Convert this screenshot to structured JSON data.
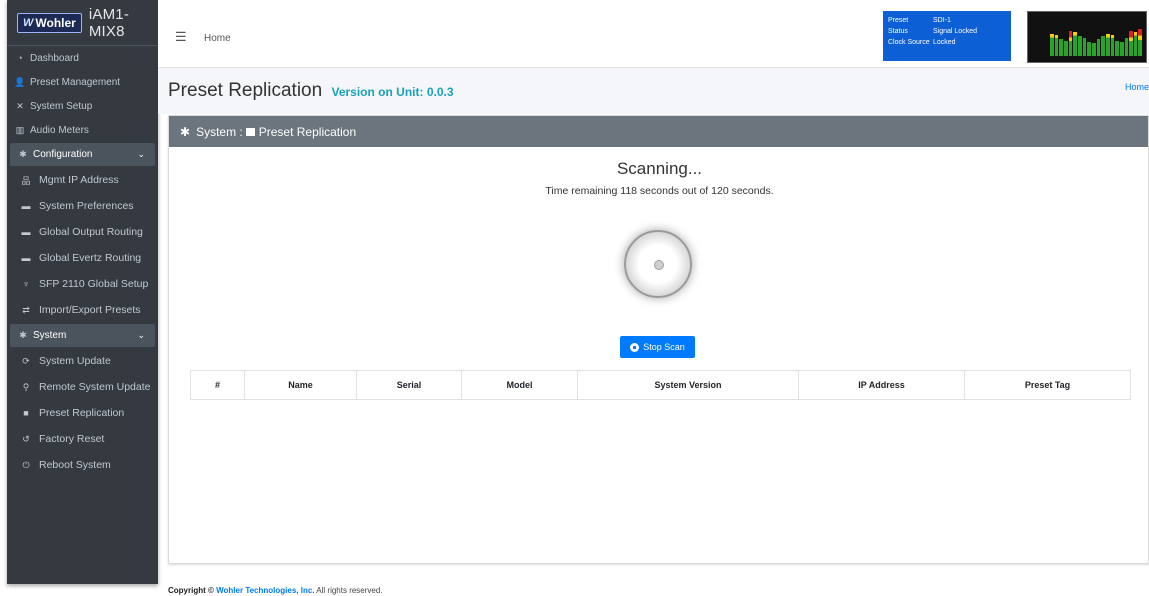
{
  "brand": {
    "logo": "Wohler",
    "product": "iAM1-MIX8"
  },
  "sidebar": {
    "items": [
      {
        "label": "Dashboard",
        "icon": "tachometer-icon"
      },
      {
        "label": "Preset Management",
        "icon": "users-icon"
      },
      {
        "label": "System Setup",
        "icon": "tools-icon"
      },
      {
        "label": "Audio Meters",
        "icon": "chart-icon"
      }
    ],
    "configuration": {
      "label": "Configuration",
      "items": [
        {
          "label": "Mgmt IP Address",
          "icon": "network-icon"
        },
        {
          "label": "System Preferences",
          "icon": "keyboard-icon"
        },
        {
          "label": "Global Output Routing",
          "icon": "keyboard-icon"
        },
        {
          "label": "Global Evertz Routing",
          "icon": "keyboard-icon"
        },
        {
          "label": "SFP 2110 Global Setup",
          "icon": "plug-icon"
        },
        {
          "label": "Import/Export Presets",
          "icon": "exchange-icon"
        }
      ]
    },
    "system": {
      "label": "System",
      "items": [
        {
          "label": "System Update",
          "icon": "sync-icon"
        },
        {
          "label": "Remote System Update",
          "icon": "sitemap-icon"
        },
        {
          "label": "Preset Replication",
          "icon": "clone-icon"
        },
        {
          "label": "Factory Reset",
          "icon": "undo-icon"
        },
        {
          "label": "Reboot System",
          "icon": "power-icon"
        }
      ]
    }
  },
  "topbar": {
    "home": "Home",
    "status": {
      "preset_label": "Preset",
      "preset_value": "SDI-1",
      "status_label": "Status",
      "status_value": "Signal Locked",
      "clock_label": "Clock Source",
      "clock_value": "Locked"
    },
    "meter_levels": [
      0.8,
      0.75,
      0.6,
      0.55,
      0.9,
      0.85,
      0.7,
      0.65,
      0.5,
      0.45,
      0.6,
      0.7,
      0.8,
      0.75,
      0.55,
      0.5,
      0.65,
      0.9,
      0.85,
      0.95
    ]
  },
  "page": {
    "title": "Preset Replication",
    "version_label": "Version on Unit: 0.0.3",
    "breadcrumb": "Home"
  },
  "card": {
    "header_system": "System :",
    "header_page": "Preset Replication",
    "scan_title": "Scanning...",
    "scan_sub": "Time remaining 118 seconds out of 120 seconds.",
    "stop_label": "Stop Scan",
    "columns": [
      "#",
      "Name",
      "Serial",
      "Model",
      "System Version",
      "IP Address",
      "Preset Tag"
    ]
  },
  "footer": {
    "copyright": "Copyright ©",
    "company": "Wohler Technologies, Inc.",
    "rights": "All rights reserved."
  },
  "colors": {
    "accent": "#007bff",
    "sidebar": "#343a40",
    "card_header": "#6c757d",
    "status_box": "#0d5fd6",
    "version": "#17a2b8"
  }
}
